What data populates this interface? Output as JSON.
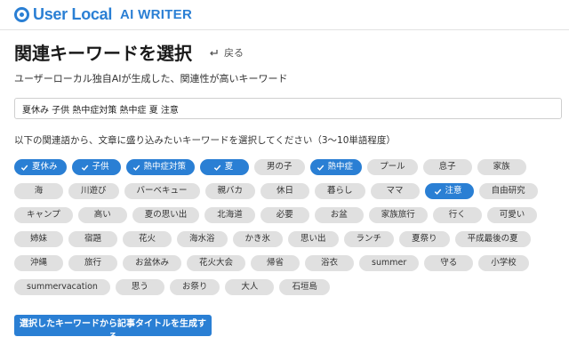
{
  "brand": {
    "name": "User Local",
    "product": "AI WRITER",
    "color": "#2a7fd4"
  },
  "header": {
    "title": "関連キーワードを選択",
    "back_label": "戻る"
  },
  "subtitle": "ユーザーローカル独自AIが生成した、関連性が高いキーワード",
  "query": {
    "value": "夏休み 子供 熱中症対策 熱中症 夏 注意"
  },
  "instruction": "以下の関連語から、文章に盛り込みたいキーワードを選択してください（3〜10単語程度）",
  "keywords": [
    {
      "label": "夏休み",
      "selected": true
    },
    {
      "label": "子供",
      "selected": true
    },
    {
      "label": "熱中症対策",
      "selected": true
    },
    {
      "label": "夏",
      "selected": true
    },
    {
      "label": "男の子",
      "selected": false
    },
    {
      "label": "熱中症",
      "selected": true
    },
    {
      "label": "プール",
      "selected": false
    },
    {
      "label": "息子",
      "selected": false
    },
    {
      "label": "家族",
      "selected": false
    },
    {
      "label": "海",
      "selected": false
    },
    {
      "label": "川遊び",
      "selected": false
    },
    {
      "label": "バーベキュー",
      "selected": false
    },
    {
      "label": "親バカ",
      "selected": false
    },
    {
      "label": "休日",
      "selected": false
    },
    {
      "label": "暮らし",
      "selected": false
    },
    {
      "label": "ママ",
      "selected": false
    },
    {
      "label": "注意",
      "selected": true
    },
    {
      "label": "自由研究",
      "selected": false
    },
    {
      "label": "キャンプ",
      "selected": false
    },
    {
      "label": "高い",
      "selected": false
    },
    {
      "label": "夏の思い出",
      "selected": false
    },
    {
      "label": "北海道",
      "selected": false
    },
    {
      "label": "必要",
      "selected": false
    },
    {
      "label": "お盆",
      "selected": false
    },
    {
      "label": "家族旅行",
      "selected": false
    },
    {
      "label": "行く",
      "selected": false
    },
    {
      "label": "可愛い",
      "selected": false
    },
    {
      "label": "姉妹",
      "selected": false
    },
    {
      "label": "宿題",
      "selected": false
    },
    {
      "label": "花火",
      "selected": false
    },
    {
      "label": "海水浴",
      "selected": false
    },
    {
      "label": "かき氷",
      "selected": false
    },
    {
      "label": "思い出",
      "selected": false
    },
    {
      "label": "ランチ",
      "selected": false
    },
    {
      "label": "夏祭り",
      "selected": false
    },
    {
      "label": "平成最後の夏",
      "selected": false
    },
    {
      "label": "沖縄",
      "selected": false
    },
    {
      "label": "旅行",
      "selected": false
    },
    {
      "label": "お盆休み",
      "selected": false
    },
    {
      "label": "花火大会",
      "selected": false
    },
    {
      "label": "帰省",
      "selected": false
    },
    {
      "label": "浴衣",
      "selected": false
    },
    {
      "label": "summer",
      "selected": false
    },
    {
      "label": "守る",
      "selected": false
    },
    {
      "label": "小学校",
      "selected": false
    },
    {
      "label": "summervacation",
      "selected": false
    },
    {
      "label": "思う",
      "selected": false
    },
    {
      "label": "お祭り",
      "selected": false
    },
    {
      "label": "大人",
      "selected": false
    },
    {
      "label": "石垣島",
      "selected": false
    }
  ],
  "generate_button": "選択したキーワードから記事タイトルを生成する"
}
